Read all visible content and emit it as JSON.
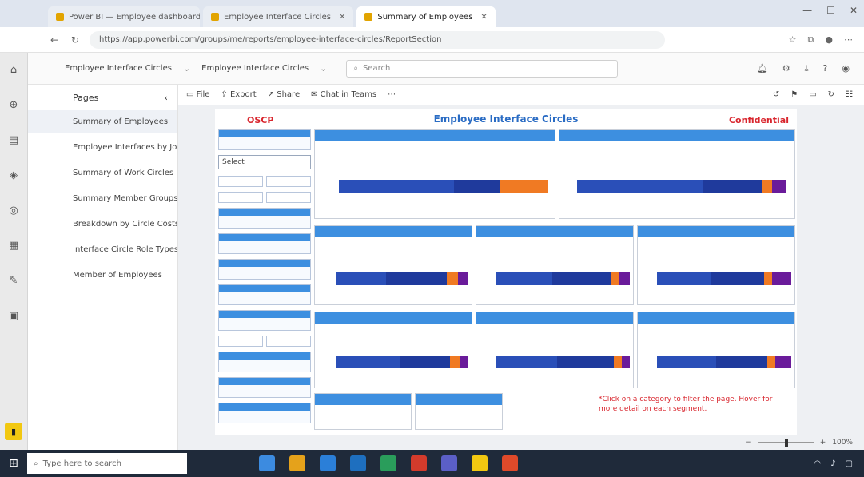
{
  "browser": {
    "tabs": [
      {
        "label": "Power BI — Employee dashboard",
        "color": "#e2a400",
        "active": false
      },
      {
        "label": "Employee Interface Circles",
        "color": "#e2a400",
        "active": false
      },
      {
        "label": "Summary of Employees",
        "color": "#e2a400",
        "active": true
      }
    ],
    "url": "https://app.powerbi.com/groups/me/reports/employee-interface-circles/ReportSection"
  },
  "pbi": {
    "breadcrumb": [
      "Employee Interface Circles",
      "Employee Interface Circles"
    ],
    "search_placeholder": "Search"
  },
  "pages": {
    "header": "Pages",
    "items": [
      "Summary of Employees",
      "Employee Interfaces by Job",
      "Summary of Work Circles",
      "Summary Member Groups",
      "Breakdown by Circle Costs",
      "Interface Circle Role Types",
      "Member of Employees"
    ]
  },
  "actionbar": {
    "file": "File",
    "export": "Export",
    "share": "Share",
    "chat": "Chat in Teams"
  },
  "report": {
    "left_tag": "OSCP",
    "title": "Employee Interface Circles",
    "right_tag": "Confidential",
    "slicer_label": "Select",
    "note": "*Click on a category to filter the page. Hover for more detail on each segment."
  },
  "zoom": {
    "level": "100%"
  },
  "taskbar": {
    "search_placeholder": "Type here to search"
  },
  "colors": {
    "accent_blue": "#3d8fe0",
    "dark_blue": "#1f3a9c",
    "orange": "#f07a23",
    "purple": "#6a1b9a",
    "red_tag": "#d9262e",
    "title_blue": "#2a6cc4"
  },
  "chart_data": [
    {
      "type": "bar",
      "card": "top-left",
      "values": [
        0.55,
        0.22,
        0.23
      ],
      "series": [
        "blue",
        "dark",
        "orange"
      ]
    },
    {
      "type": "bar",
      "card": "top-right",
      "values": [
        0.6,
        0.3,
        0.1
      ],
      "series": [
        "blue",
        "dark",
        "purple"
      ]
    }
  ]
}
